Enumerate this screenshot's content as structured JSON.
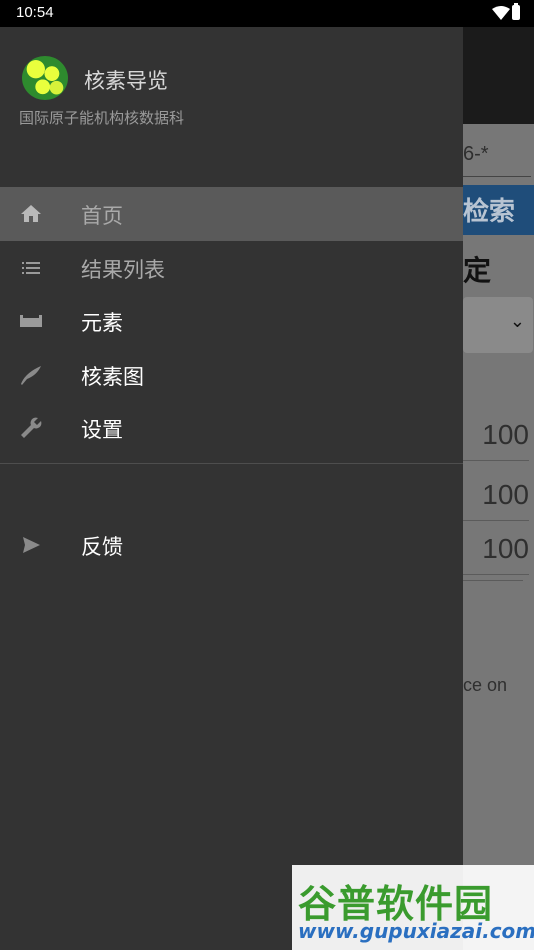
{
  "status_bar": {
    "time": "10:54"
  },
  "background_app": {
    "input_fragment": "6-*",
    "search_button_fragment": "检索",
    "title_fragment": "定",
    "dropdown_chevron": "⌄",
    "number_fields": [
      "100",
      "100",
      "100"
    ],
    "note_fragment": "ce on"
  },
  "drawer": {
    "app_name": "核素导览",
    "app_subtitle": "国际原子能机构核数据科",
    "menu_items": [
      {
        "label": "首页",
        "icon": "home-icon"
      },
      {
        "label": "结果列表",
        "icon": "list-icon"
      },
      {
        "label": "元素",
        "icon": "element-table-icon"
      },
      {
        "label": "核素图",
        "icon": "chart-curve-icon"
      },
      {
        "label": "设置",
        "icon": "wrench-icon"
      }
    ],
    "secondary_items": [
      {
        "label": "反馈",
        "icon": "send-icon"
      }
    ]
  },
  "watermark": {
    "title": "谷普软件园",
    "url": "www.gupuxiazai.com"
  },
  "colors": {
    "drawer_bg": "#333333",
    "active_item_bg": "#5a5a5a",
    "search_button": "#1f4d7a"
  }
}
